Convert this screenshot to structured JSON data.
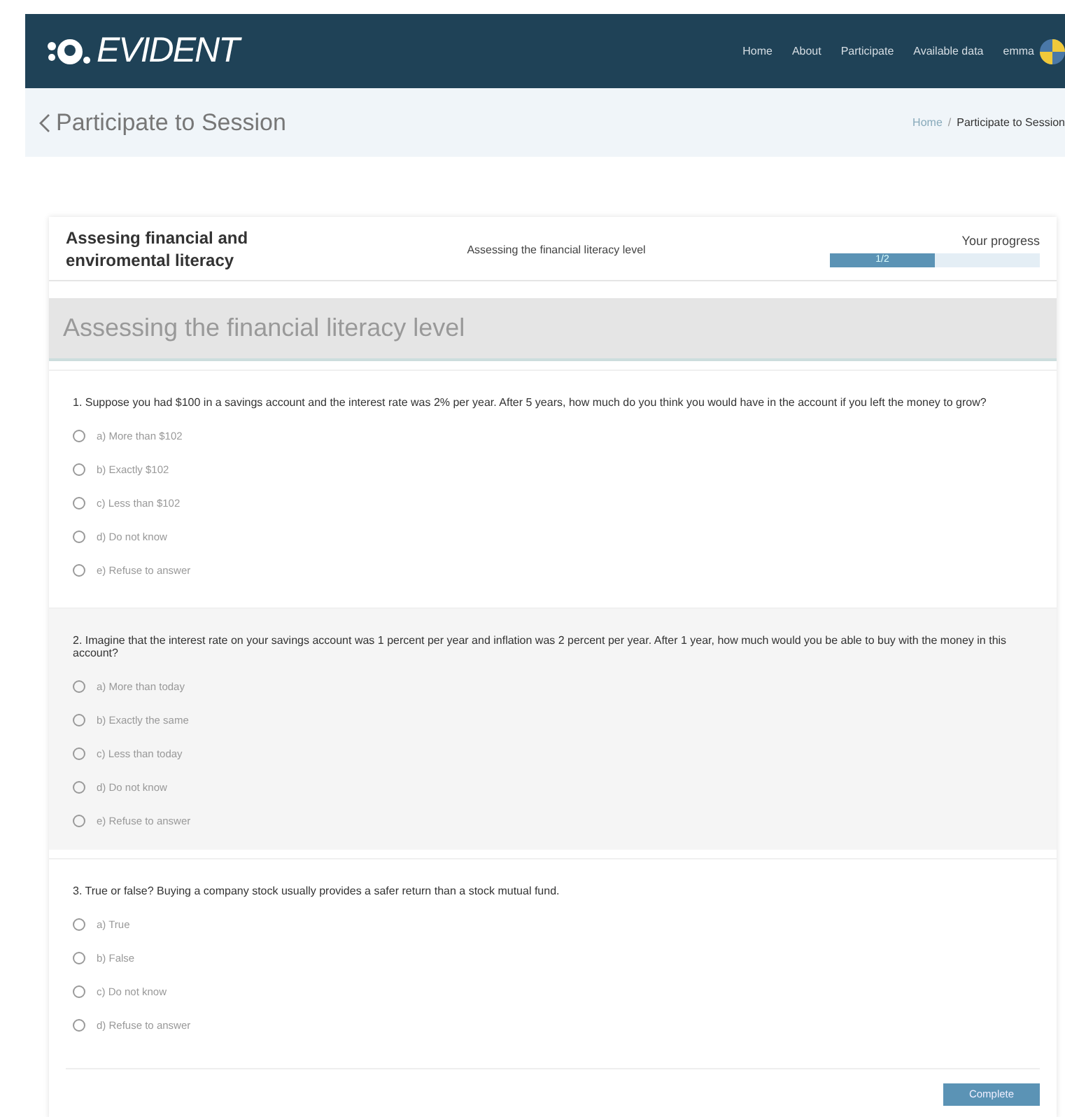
{
  "navbar": {
    "logo": "EVIDENT",
    "links": [
      "Home",
      "About",
      "Participate",
      "Available data"
    ],
    "user": "emma"
  },
  "page_header": {
    "title": "Participate to Session",
    "breadcrumb": [
      "Home",
      "Participate to Session"
    ],
    "breadcrumb_separator": "/"
  },
  "survey": {
    "title": "Assesing financial and enviromental literacy",
    "section_label": "Assessing the financial literacy level",
    "progress": {
      "label": "Your progress",
      "reading": "1/2",
      "level": 0.5
    }
  },
  "section_title": "Assessing the financial literacy level",
  "questions": [
    {
      "text": "1.  Suppose you had $100 in a savings account and the interest rate was 2% per year. After 5 years, how much do you think you would have in the account if you left the money to grow?",
      "options": [
        {
          "label": "a) More than $102",
          "selected": false
        },
        {
          "label": "b) Exactly $102",
          "selected": false
        },
        {
          "label": "c) Less than $102",
          "selected": false
        },
        {
          "label": "d) Do not know",
          "selected": false
        },
        {
          "label": "e) Refuse to answer",
          "selected": false
        }
      ]
    },
    {
      "text": "2.  Imagine that the interest rate on your savings account was 1 percent per year and inflation was 2 percent per year. After 1 year, how much would you be able to buy with the money in this account?",
      "options": [
        {
          "label": "a) More than today",
          "selected": false
        },
        {
          "label": "b) Exactly the same",
          "selected": false
        },
        {
          "label": "c) Less than today",
          "selected": false
        },
        {
          "label": "d) Do not know",
          "selected": false
        },
        {
          "label": "e) Refuse to answer",
          "selected": false
        }
      ]
    },
    {
      "text": "3.  True or false? Buying a company stock usually provides a safer return than a stock mutual fund.",
      "options": [
        {
          "label": "a) True",
          "selected": false
        },
        {
          "label": "b) False",
          "selected": false
        },
        {
          "label": "c) Do not know",
          "selected": false
        },
        {
          "label": "d) Refuse to answer",
          "selected": false
        }
      ]
    }
  ],
  "submit_button": "Complete"
}
